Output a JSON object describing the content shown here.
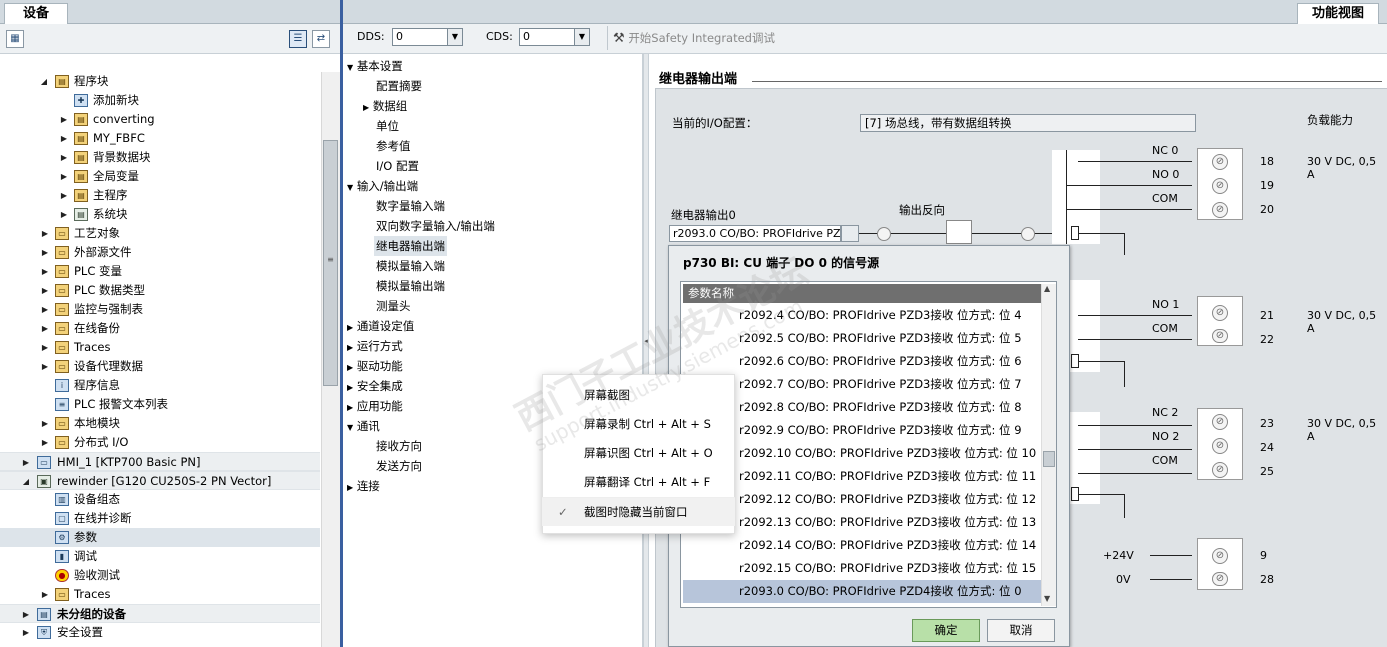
{
  "left_panel": {
    "tab": "设备",
    "toolbar": {
      "left_icon": "properties-icon",
      "right_icons": [
        "list-view-icon",
        "project-icon"
      ]
    },
    "tree": [
      {
        "label": "程序块",
        "icon": "folder-block-icon",
        "expanded": true
      },
      {
        "label": "添加新块",
        "icon": "add-block-icon"
      },
      {
        "label": "converting",
        "icon": "folder-block-icon"
      },
      {
        "label": "MY_FBFC",
        "icon": "folder-block-icon"
      },
      {
        "label": "背景数据块",
        "icon": "folder-block-icon"
      },
      {
        "label": "全局变量",
        "icon": "folder-block-icon"
      },
      {
        "label": "主程序",
        "icon": "folder-block-icon"
      },
      {
        "label": "系统块",
        "icon": "folder-block-icon"
      },
      {
        "label": "工艺对象",
        "icon": "folder-icon"
      },
      {
        "label": "外部源文件",
        "icon": "folder-icon"
      },
      {
        "label": "PLC 变量",
        "icon": "folder-icon"
      },
      {
        "label": "PLC 数据类型",
        "icon": "folder-icon"
      },
      {
        "label": "监控与强制表",
        "icon": "folder-icon"
      },
      {
        "label": "在线备份",
        "icon": "folder-icon"
      },
      {
        "label": "Traces",
        "icon": "folder-icon"
      },
      {
        "label": "设备代理数据",
        "icon": "folder-icon"
      },
      {
        "label": "程序信息",
        "icon": "info-icon"
      },
      {
        "label": "PLC 报警文本列表",
        "icon": "alarm-list-icon"
      },
      {
        "label": "本地模块",
        "icon": "folder-icon"
      },
      {
        "label": "分布式 I/O",
        "icon": "folder-icon"
      },
      {
        "label": "HMI_1 [KTP700 Basic PN]",
        "icon": "hmi-icon"
      },
      {
        "label": "rewinder [G120 CU250S-2 PN Vector]",
        "icon": "drive-icon"
      },
      {
        "label": "设备组态",
        "icon": "device-config-icon"
      },
      {
        "label": "在线并诊断",
        "icon": "online-diag-icon"
      },
      {
        "label": "参数",
        "icon": "parameter-icon"
      },
      {
        "label": "调试",
        "icon": "commissioning-icon"
      },
      {
        "label": "验收测试",
        "icon": "acceptance-test-icon"
      },
      {
        "label": "Traces",
        "icon": "folder-icon"
      },
      {
        "label": "未分组的设备",
        "icon": "ungrouped-icon"
      },
      {
        "label": "安全设置",
        "icon": "security-icon"
      }
    ]
  },
  "right_header": {
    "tab": "功能视图",
    "dds_label": "DDS:",
    "dds_value": "0",
    "cds_label": "CDS:",
    "cds_value": "0",
    "safety_button": "开始Safety Integrated调试"
  },
  "nav": [
    {
      "label": "基本设置",
      "level": 0,
      "expanded": true
    },
    {
      "label": "配置摘要",
      "level": 1
    },
    {
      "label": "数据组",
      "level": 1,
      "collapsed": true
    },
    {
      "label": "单位",
      "level": 1
    },
    {
      "label": "参考值",
      "level": 1
    },
    {
      "label": "I/O 配置",
      "level": 1
    },
    {
      "label": "输入/输出端",
      "level": 0,
      "expanded": true
    },
    {
      "label": "数字量输入端",
      "level": 1
    },
    {
      "label": "双向数字量输入/输出端",
      "level": 1
    },
    {
      "label": "继电器输出端",
      "level": 1,
      "selected": true
    },
    {
      "label": "模拟量输入端",
      "level": 1
    },
    {
      "label": "模拟量输出端",
      "level": 1
    },
    {
      "label": "测量头",
      "level": 1
    },
    {
      "label": "通道设定值",
      "level": 0
    },
    {
      "label": "运行方式",
      "level": 0
    },
    {
      "label": "驱动功能",
      "level": 0
    },
    {
      "label": "安全集成",
      "level": 0
    },
    {
      "label": "应用功能",
      "level": 0
    },
    {
      "label": "通讯",
      "level": 0,
      "expanded": true
    },
    {
      "label": "接收方向",
      "level": 1
    },
    {
      "label": "发送方向",
      "level": 1
    },
    {
      "label": "连接",
      "level": 0
    }
  ],
  "content": {
    "title": "继电器输出端",
    "io_config_label": "当前的I/O配置：",
    "io_config_value": "[7] 场总线，带有数据组转换",
    "load_capacity_label": "负载能力",
    "relay_output_label": "继电器输出0",
    "relay_output_value": "r2093.0 CO/BO: PROFIdrive PZD",
    "invert_label": "输出反向",
    "relays": [
      {
        "pins": [
          {
            "name": "NC 0",
            "num": "18"
          },
          {
            "name": "NO 0",
            "num": "19"
          },
          {
            "name": "COM",
            "num": "20"
          }
        ],
        "rating": "30 V DC, 0,5 A"
      },
      {
        "pins": [
          {
            "name": "NO 1",
            "num": "21"
          },
          {
            "name": "COM",
            "num": "22"
          }
        ],
        "rating": "30 V DC, 0,5 A"
      },
      {
        "pins": [
          {
            "name": "NC 2",
            "num": "23"
          },
          {
            "name": "NO 2",
            "num": "24"
          },
          {
            "name": "COM",
            "num": "25"
          }
        ],
        "rating": "30 V DC, 0,5 A"
      }
    ],
    "supply_pins": [
      {
        "name": "+24V",
        "num": "9"
      },
      {
        "name": "0V",
        "num": "28"
      }
    ]
  },
  "dialog": {
    "title": "p730 BI: CU 端子 DO 0 的信号源",
    "column_header": "参数名称",
    "items": [
      "r2092.4 CO/BO: PROFIdrive PZD3接收 位方式: 位 4",
      "r2092.5 CO/BO: PROFIdrive PZD3接收 位方式: 位 5",
      "r2092.6 CO/BO: PROFIdrive PZD3接收 位方式: 位 6",
      "r2092.7 CO/BO: PROFIdrive PZD3接收 位方式: 位 7",
      "r2092.8 CO/BO: PROFIdrive PZD3接收 位方式: 位 8",
      "r2092.9 CO/BO: PROFIdrive PZD3接收 位方式: 位 9",
      "r2092.10 CO/BO: PROFIdrive PZD3接收 位方式: 位 10",
      "r2092.11 CO/BO: PROFIdrive PZD3接收 位方式: 位 11",
      "r2092.12 CO/BO: PROFIdrive PZD3接收 位方式: 位 12",
      "r2092.13 CO/BO: PROFIdrive PZD3接收 位方式: 位 13",
      "r2092.14 CO/BO: PROFIdrive PZD3接收 位方式: 位 14",
      "r2092.15 CO/BO: PROFIdrive PZD3接收 位方式: 位 15",
      "r2093.0 CO/BO: PROFIdrive PZD4接收 位方式: 位 0"
    ],
    "selected_index": 12,
    "ok_button": "确定",
    "cancel_button": "取消"
  },
  "context_menu": [
    {
      "label": "屏幕截图"
    },
    {
      "label": "屏幕录制 Ctrl + Alt + S"
    },
    {
      "label": "屏幕识图 Ctrl + Alt + O"
    },
    {
      "label": "屏幕翻译 Ctrl + Alt + F"
    },
    {
      "label": "截图时隐藏当前窗口",
      "checked": true
    }
  ],
  "watermark": {
    "line1": "西门子工业技术论坛",
    "line2": "support.industry.siemens.com"
  },
  "colors": {
    "accent_blue": "#3a5fa0",
    "selection": "#b7c5da",
    "ok_green": "#b8e0a8",
    "header_gray": "#6f6f6f"
  }
}
